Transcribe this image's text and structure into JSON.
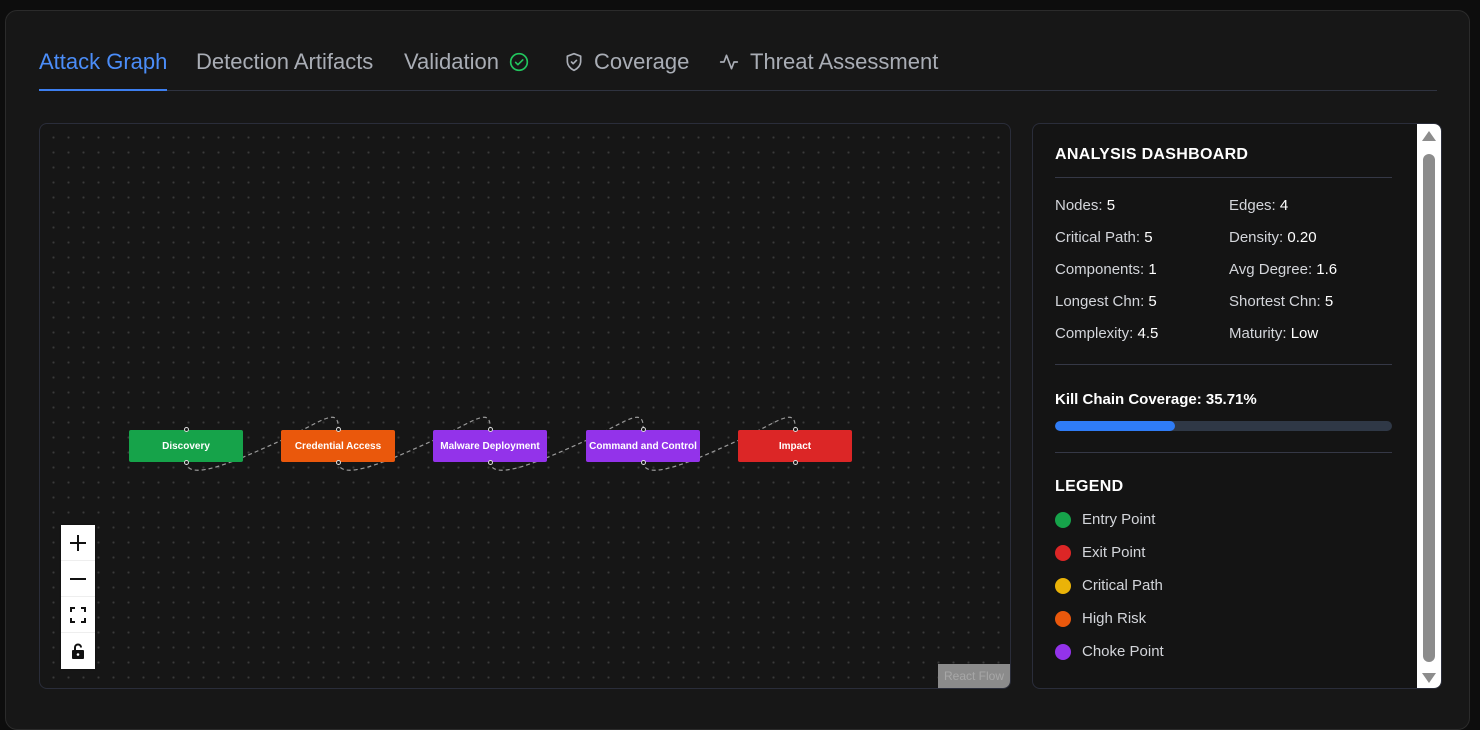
{
  "tabs": [
    {
      "label": "Attack Graph",
      "active": true,
      "icon": ""
    },
    {
      "label": "Detection Artifacts",
      "active": false,
      "icon": ""
    },
    {
      "label": "Validation",
      "active": false,
      "icon": "check-circle-icon"
    },
    {
      "label": "Coverage",
      "active": false,
      "icon": "shield-check-icon"
    },
    {
      "label": "Threat Assessment",
      "active": false,
      "icon": "activity-icon"
    }
  ],
  "graph": {
    "nodes": [
      {
        "label": "Discovery",
        "color": "#16a34a"
      },
      {
        "label": "Credential Access",
        "color": "#ea580c"
      },
      {
        "label": "Malware Deployment",
        "color": "#9333ea"
      },
      {
        "label": "Command and Control",
        "color": "#9333ea"
      },
      {
        "label": "Impact",
        "color": "#dc2626"
      }
    ],
    "attribution": "React Flow",
    "controls": [
      "zoom-in-icon",
      "zoom-out-icon",
      "fit-view-icon",
      "lock-icon"
    ]
  },
  "dashboard": {
    "title": "ANALYSIS DASHBOARD",
    "stats": [
      {
        "label": "Nodes:",
        "value": "5"
      },
      {
        "label": "Edges:",
        "value": "4"
      },
      {
        "label": "Critical Path:",
        "value": "5"
      },
      {
        "label": "Density:",
        "value": "0.20"
      },
      {
        "label": "Components:",
        "value": "1"
      },
      {
        "label": "Avg Degree:",
        "value": "1.6"
      },
      {
        "label": "Longest Chn:",
        "value": "5"
      },
      {
        "label": "Shortest Chn:",
        "value": "5"
      },
      {
        "label": "Complexity:",
        "value": "4.5"
      },
      {
        "label": "Maturity:",
        "value": "Low"
      }
    ],
    "kill_chain_label": "Kill Chain Coverage: 35.71%",
    "kill_chain_percent": 35.71,
    "legend_title": "LEGEND",
    "legend": [
      {
        "label": "Entry Point",
        "color": "#16a34a"
      },
      {
        "label": "Exit Point",
        "color": "#dc2626"
      },
      {
        "label": "Critical Path",
        "color": "#eab308"
      },
      {
        "label": "High Risk",
        "color": "#ea580c"
      },
      {
        "label": "Choke Point",
        "color": "#9333ea"
      }
    ]
  }
}
